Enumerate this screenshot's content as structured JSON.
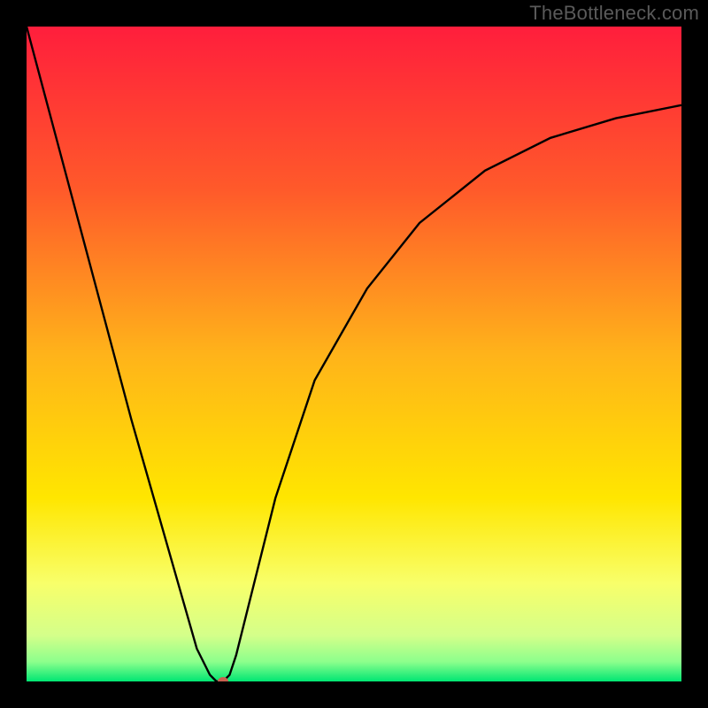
{
  "watermark": "TheBottleneck.com",
  "chart_data": {
    "type": "line",
    "title": "",
    "xlabel": "",
    "ylabel": "",
    "xlim": [
      0,
      100
    ],
    "ylim": [
      0,
      100
    ],
    "grid": false,
    "legend": false,
    "background_gradient_stops": [
      {
        "offset": 0.0,
        "color": "#ff1e3c"
      },
      {
        "offset": 0.25,
        "color": "#ff5a2a"
      },
      {
        "offset": 0.5,
        "color": "#ffb31a"
      },
      {
        "offset": 0.72,
        "color": "#ffe600"
      },
      {
        "offset": 0.85,
        "color": "#f8ff6a"
      },
      {
        "offset": 0.93,
        "color": "#d4ff8a"
      },
      {
        "offset": 0.97,
        "color": "#8cff8c"
      },
      {
        "offset": 1.0,
        "color": "#00e673"
      }
    ],
    "series": [
      {
        "name": "bottleneck-curve",
        "color": "#000000",
        "x": [
          0,
          4,
          8,
          12,
          16,
          20,
          24,
          26,
          28,
          29,
          30,
          31,
          32,
          34,
          38,
          44,
          52,
          60,
          70,
          80,
          90,
          100
        ],
        "y": [
          100,
          85,
          70,
          55,
          40,
          26,
          12,
          5,
          1,
          0,
          0,
          1,
          4,
          12,
          28,
          46,
          60,
          70,
          78,
          83,
          86,
          88
        ]
      }
    ],
    "marker": {
      "name": "optimal-point",
      "x": 30,
      "y": 0,
      "color": "#c9604f",
      "rx": 6,
      "ry": 5
    }
  }
}
